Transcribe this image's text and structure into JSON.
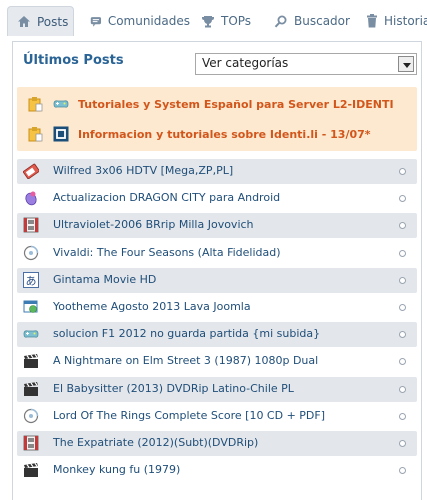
{
  "nav": {
    "items": [
      {
        "label": "Posts",
        "icon": "home-icon",
        "active": true
      },
      {
        "label": "Comunidades",
        "icon": "chat-icon",
        "active": false
      },
      {
        "label": "TOPs",
        "icon": "trophy-icon",
        "active": false
      },
      {
        "label": "Buscador",
        "icon": "search-icon",
        "active": false
      },
      {
        "label": "Historial",
        "icon": "trash-icon",
        "active": false
      }
    ]
  },
  "panel": {
    "title": "Últimos Posts",
    "category_select": "Ver categorías"
  },
  "sticky_posts": [
    {
      "title": "Tutoriales y System Español para Server L2-IDENTI",
      "icon": "pin-icon"
    },
    {
      "title": "Informacion y tutoriales sobre Identi.li - 13/07*",
      "icon": "pin-icon"
    }
  ],
  "posts": [
    {
      "title": "Wilfred 3x06 HDTV [Mega,ZP,PL]",
      "icon": "tv-icon"
    },
    {
      "title": "Actualizacion DRAGON CITY para Android",
      "icon": "android-icon"
    },
    {
      "title": "Ultraviolet-2006 BRrip Milla Jovovich",
      "icon": "film-icon"
    },
    {
      "title": "Vivaldi: The Four Seasons (Alta Fidelidad)",
      "icon": "music-icon"
    },
    {
      "title": "Gintama Movie HD",
      "icon": "anime-icon"
    },
    {
      "title": "Yootheme Agosto 2013 Lava Joomla",
      "icon": "web-icon"
    },
    {
      "title": "solucion F1 2012 no guarda partida {mi subida}",
      "icon": "gamepad-icon"
    },
    {
      "title": "A Nightmare on Elm Street 3 (1987) 1080p Dual",
      "icon": "clapper-icon"
    },
    {
      "title": "El Babysitter (2013) DVDRip Latino-Chile PL",
      "icon": "clapper-icon"
    },
    {
      "title": "Lord Of The Rings Complete Score [10 CD + PDF]",
      "icon": "music-icon"
    },
    {
      "title": "The Expatriate (2012)(Subt)(DVDRip)",
      "icon": "film-icon"
    },
    {
      "title": "Monkey kung fu (1979)",
      "icon": "clapper-icon"
    }
  ]
}
